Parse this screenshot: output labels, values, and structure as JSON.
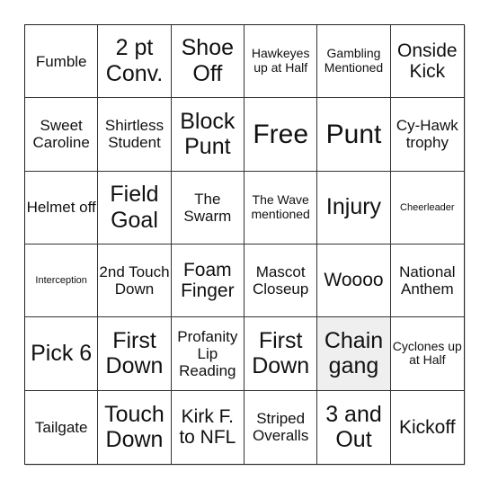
{
  "board": {
    "size": 6,
    "marked_color": "#f0efef",
    "cells": [
      {
        "text": "Fumble",
        "size": "md",
        "marked": false
      },
      {
        "text": "2 pt Conv.",
        "size": "xl",
        "marked": false
      },
      {
        "text": "Shoe Off",
        "size": "xl",
        "marked": false
      },
      {
        "text": "Hawkeyes up at Half",
        "size": "sm",
        "marked": false
      },
      {
        "text": "Gambling Mentioned",
        "size": "sm",
        "marked": false
      },
      {
        "text": "Onside Kick",
        "size": "lg",
        "marked": false
      },
      {
        "text": "Sweet Caroline",
        "size": "md",
        "marked": false
      },
      {
        "text": "Shirtless Student",
        "size": "md",
        "marked": false
      },
      {
        "text": "Block Punt",
        "size": "xl",
        "marked": false
      },
      {
        "text": "Free",
        "size": "xxl",
        "marked": false
      },
      {
        "text": "Punt",
        "size": "xxl",
        "marked": false
      },
      {
        "text": "Cy-Hawk trophy",
        "size": "md",
        "marked": false
      },
      {
        "text": "Helmet off",
        "size": "md",
        "marked": false
      },
      {
        "text": "Field Goal",
        "size": "xl",
        "marked": false
      },
      {
        "text": "The Swarm",
        "size": "md",
        "marked": false
      },
      {
        "text": "The Wave mentioned",
        "size": "sm",
        "marked": false
      },
      {
        "text": "Injury",
        "size": "xl",
        "marked": false
      },
      {
        "text": "Cheerleader",
        "size": "xs",
        "marked": false
      },
      {
        "text": "Interception",
        "size": "xs",
        "marked": false
      },
      {
        "text": "2nd Touch Down",
        "size": "md",
        "marked": false
      },
      {
        "text": "Foam Finger",
        "size": "lg",
        "marked": false
      },
      {
        "text": "Mascot Closeup",
        "size": "md",
        "marked": false
      },
      {
        "text": "Woooo",
        "size": "lg",
        "marked": false
      },
      {
        "text": "National Anthem",
        "size": "md",
        "marked": false
      },
      {
        "text": "Pick 6",
        "size": "xl",
        "marked": false
      },
      {
        "text": "First Down",
        "size": "xl",
        "marked": false
      },
      {
        "text": "Profanity Lip Reading",
        "size": "md",
        "marked": false
      },
      {
        "text": "First Down",
        "size": "xl",
        "marked": false
      },
      {
        "text": "Chain gang",
        "size": "xl",
        "marked": true
      },
      {
        "text": "Cyclones up at Half",
        "size": "sm",
        "marked": false
      },
      {
        "text": "Tailgate",
        "size": "md",
        "marked": false
      },
      {
        "text": "Touch Down",
        "size": "xl",
        "marked": false
      },
      {
        "text": "Kirk F. to NFL",
        "size": "lg",
        "marked": false
      },
      {
        "text": "Striped Overalls",
        "size": "md",
        "marked": false
      },
      {
        "text": "3 and Out",
        "size": "xl",
        "marked": false
      },
      {
        "text": "Kickoff",
        "size": "lg",
        "marked": false
      }
    ]
  }
}
